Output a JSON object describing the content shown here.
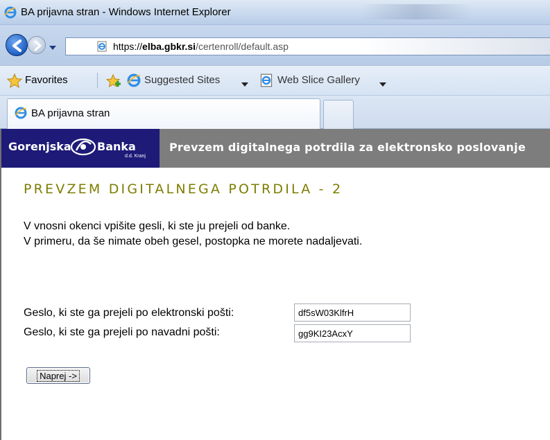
{
  "window": {
    "title": "BA prijavna stran - Windows Internet Explorer"
  },
  "address_bar": {
    "url_prefix": "https://",
    "url_domain": "elba.gbkr.si",
    "url_path": "/certenroll/default.asp"
  },
  "favorites_bar": {
    "favorites_label": "Favorites",
    "suggested_sites_label": "Suggested Sites",
    "web_slice_gallery_label": "Web Slice Gallery"
  },
  "tabs": [
    {
      "label": "BA prijavna stran"
    }
  ],
  "page": {
    "logo": {
      "part1": "Gorenjska",
      "part2": "Banka",
      "sub": "d.d. Kranj"
    },
    "header_title": "Prevzem digitalnega potrdila za elektronsko poslovanje",
    "heading": "PREVZEM DIGITALNEGA POTRDILA - 2",
    "instructions": [
      "V vnosni okenci vpišite gesli, ki ste ju prejeli od banke.",
      "V primeru, da še nimate obeh gesel, postopka ne morete nadaljevati."
    ],
    "fields": {
      "email_password": {
        "label": "Geslo, ki ste ga prejeli po elektronski pošti:",
        "value": "df5sW03KlfrH"
      },
      "mail_password": {
        "label": "Geslo, ki ste ga prejeli po navadni pošti:",
        "value": "gg9KI23AcxY"
      }
    },
    "next_button_label": "Naprej ->"
  },
  "colors": {
    "logo_background": "#1d1a78",
    "header_background": "#7d7d7d",
    "heading_color": "#7d7d00"
  }
}
